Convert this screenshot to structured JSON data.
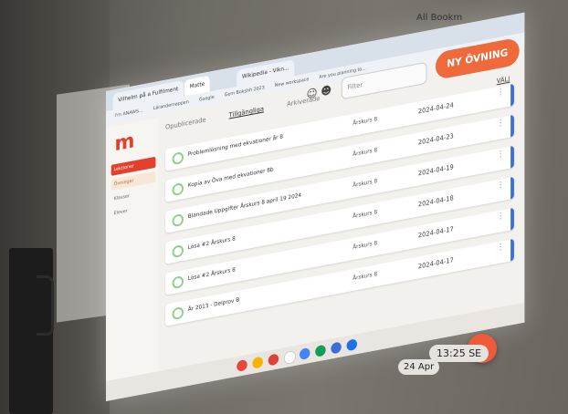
{
  "browser": {
    "tabs": [
      "Vilhelm på a Fulfilment",
      "Matte",
      "Wikipedia - Vikn..."
    ],
    "bookmarks": [
      "I'm ANAWS...",
      "Lärandemappen",
      "Google",
      "Gem Bokshh 2023",
      "New workspace",
      "Are you planning to..."
    ],
    "all_bookmarks": "All Bookm"
  },
  "app": {
    "logo": "m",
    "sidebar": [
      {
        "label": "Lektioner"
      },
      {
        "label": "Övningar"
      },
      {
        "label": "Klasser"
      },
      {
        "label": "Elever"
      }
    ],
    "tabs": [
      "Opublicerade",
      "Tillgängliga",
      "Arkiverade"
    ],
    "filter_placeholder": "Filter",
    "new_button": "NY ÖVNING",
    "select_label": "VÄLJ",
    "exercises": [
      {
        "title": "Problemlösning med ekvationer år 8",
        "class": "Årskurs 8",
        "date": "2024-04-24"
      },
      {
        "title": "Kopia av Öva med ekvationer 8b",
        "class": "Årskurs 8",
        "date": "2024-04-23"
      },
      {
        "title": "Blandade Uppgifter Årskurs 8 april 19 2024",
        "class": "Årskurs 8",
        "date": "2024-04-19"
      },
      {
        "title": "Lösa #2 Årskurs 8",
        "class": "Årskurs 8",
        "date": "2024-04-18"
      },
      {
        "title": "Lösa #2 Årskurs 8",
        "class": "Årskurs 8",
        "date": "2024-04-17"
      },
      {
        "title": "År 2013 - Delprov B",
        "class": "Årskurs 8",
        "date": "2024-04-17"
      }
    ]
  },
  "system": {
    "date": "24 Apr",
    "time": "13:25",
    "locale": "SE"
  },
  "colors": {
    "accent": "#ef6a3a",
    "brand": "#e0402c",
    "row_edge": "#3b6fd6"
  }
}
